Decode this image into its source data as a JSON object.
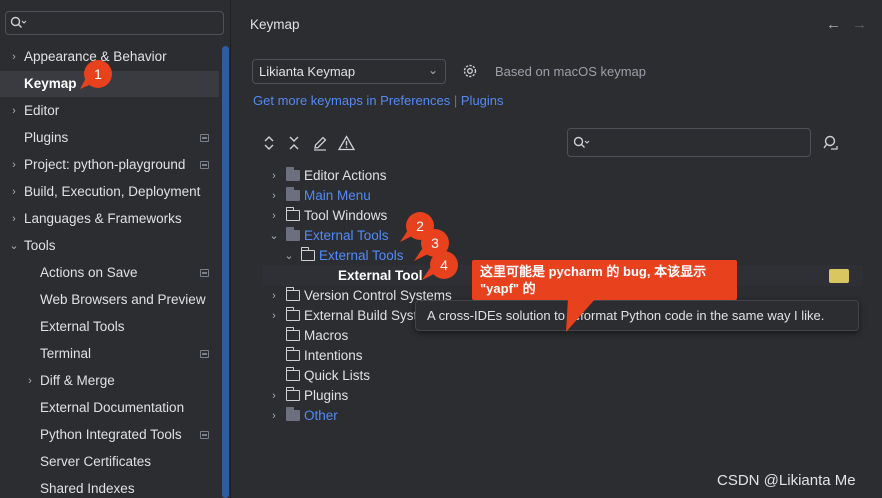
{
  "sidebar": {
    "items": [
      {
        "label": "Appearance & Behavior",
        "arrow": "›",
        "indent": 0,
        "bold": true
      },
      {
        "label": "Keymap",
        "arrow": "",
        "indent": 0,
        "bold": true,
        "selected": true
      },
      {
        "label": "Editor",
        "arrow": "›",
        "indent": 0,
        "bold": true
      },
      {
        "label": "Plugins",
        "arrow": "",
        "indent": 0,
        "bold": true,
        "mark": true
      },
      {
        "label": "Project: python-playground",
        "arrow": "›",
        "indent": 0,
        "bold": true,
        "mark": true
      },
      {
        "label": "Build, Execution, Deployment",
        "arrow": "›",
        "indent": 0,
        "bold": true
      },
      {
        "label": "Languages & Frameworks",
        "arrow": "›",
        "indent": 0,
        "bold": true
      },
      {
        "label": "Tools",
        "arrow": "⌄",
        "indent": 0,
        "bold": true
      },
      {
        "label": "Actions on Save",
        "arrow": "",
        "indent": 1,
        "mark": true
      },
      {
        "label": "Web Browsers and Preview",
        "arrow": "",
        "indent": 1
      },
      {
        "label": "External Tools",
        "arrow": "",
        "indent": 1
      },
      {
        "label": "Terminal",
        "arrow": "",
        "indent": 1,
        "mark": true
      },
      {
        "label": "Diff & Merge",
        "arrow": "›",
        "indent": 1
      },
      {
        "label": "External Documentation",
        "arrow": "",
        "indent": 1
      },
      {
        "label": "Python Integrated Tools",
        "arrow": "",
        "indent": 1,
        "mark": true
      },
      {
        "label": "Server Certificates",
        "arrow": "",
        "indent": 1
      },
      {
        "label": "Shared Indexes",
        "arrow": "",
        "indent": 1
      }
    ]
  },
  "header": {
    "title": "Keymap",
    "back_icon": "arrow-left-icon",
    "forward_icon": "arrow-right-icon"
  },
  "keymap": {
    "selected": "Likianta Keymap",
    "based_on": "Based on macOS keymap",
    "link_get_more": "Get more keymaps in Preferences",
    "link_separator": "|",
    "link_plugins": "Plugins"
  },
  "toolbar": {
    "icons": [
      "expand-collapse-icon",
      "collapse-all-icon",
      "edit-icon",
      "warning-icon"
    ]
  },
  "keymap_tree": [
    {
      "label": "Editor Actions",
      "arrow": "›",
      "indent": 0,
      "color": "normal",
      "folder": "dark"
    },
    {
      "label": "Main Menu",
      "arrow": "›",
      "indent": 0,
      "color": "blue",
      "folder": "dark"
    },
    {
      "label": "Tool Windows",
      "arrow": "›",
      "indent": 0,
      "color": "normal",
      "folder": "outline"
    },
    {
      "label": "External Tools",
      "arrow": "⌄",
      "indent": 0,
      "color": "blue",
      "folder": "dark"
    },
    {
      "label": "External Tools",
      "arrow": "⌄",
      "indent": 1,
      "color": "blue",
      "folder": "outline"
    },
    {
      "label": "External Tool",
      "arrow": "",
      "indent": 2,
      "color": "white",
      "folder": "none"
    },
    {
      "label": "Version Control Systems",
      "arrow": "›",
      "indent": 0,
      "color": "normal",
      "folder": "outline"
    },
    {
      "label": "External Build Systems",
      "arrow": "›",
      "indent": 0,
      "color": "normal",
      "folder": "outline"
    },
    {
      "label": "Macros",
      "arrow": "",
      "indent": 0,
      "color": "normal",
      "folder": "outline"
    },
    {
      "label": "Intentions",
      "arrow": "",
      "indent": 0,
      "color": "normal",
      "folder": "outline"
    },
    {
      "label": "Quick Lists",
      "arrow": "",
      "indent": 0,
      "color": "normal",
      "folder": "outline"
    },
    {
      "label": "Plugins",
      "arrow": "›",
      "indent": 0,
      "color": "normal",
      "folder": "outline"
    },
    {
      "label": "Other",
      "arrow": "›",
      "indent": 0,
      "color": "blue",
      "folder": "dark"
    }
  ],
  "tooltip": {
    "text": "A cross-IDEs solution to reformat Python code in the same way I like."
  },
  "annotation": {
    "callout_line1": "这里可能是 pycharm 的 bug, 本该显示",
    "callout_line2": "\"yapf\" 的",
    "badges": [
      "1",
      "2",
      "3",
      "4"
    ]
  },
  "watermark": "CSDN @Likianta Me",
  "colors": {
    "accent": "#548af7",
    "annotation": "#e8411d",
    "background": "#2b2d30"
  }
}
